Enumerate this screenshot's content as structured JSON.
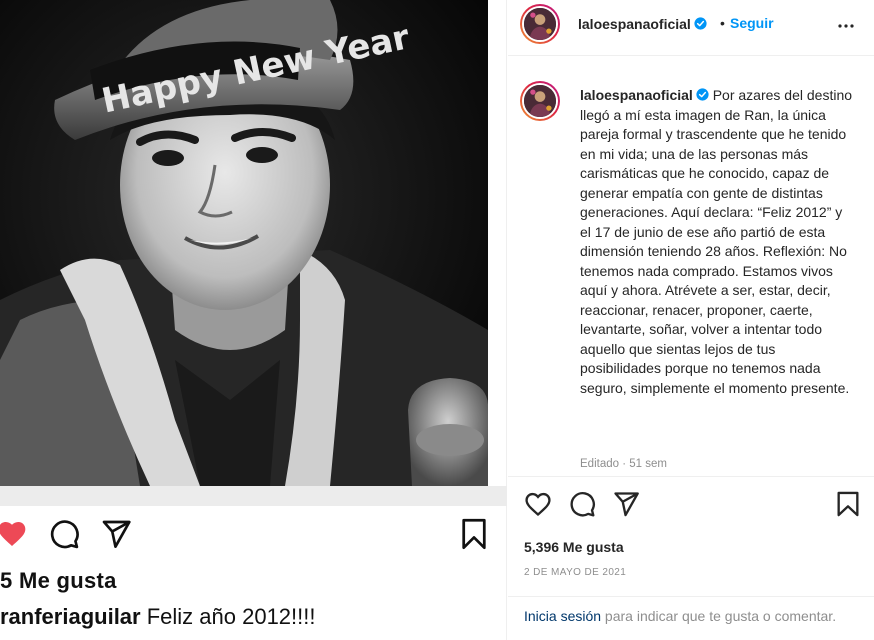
{
  "post": {
    "username": "laloespanaoficial",
    "follow_label": "Seguir",
    "dot": "•",
    "caption_text": "Por azares del destino llegó a mí esta imagen de Ran, la única pareja formal y trascendente que he tenido en mi vida; una de las personas más carismáticas que he conocido, capaz de generar empatía con gente de distintas generaciones. Aquí declara: “Feliz 2012” y el 17 de junio de ese año partió de esta dimensión teniendo 28 años. Reflexión: No tenemos nada comprado. Estamos vivos aquí y ahora. Atrévete a ser, estar, decir, reaccionar, renacer, proponer, caerte, levantarte, soñar, volver a intentar todo aquello que sientas lejos de tus posibilidades porque no tenemos nada seguro, simplemente el momento presente.",
    "edited": "Editado · 51 sem",
    "likes": "5,396 Me gusta",
    "date": "2 DE MAYO DE 2021",
    "login_link": "Inicia sesión",
    "login_rest": " para indicar que te gusta o comentar."
  },
  "embedded_post": {
    "hat_text": "Happy New Year",
    "likes": "5 Me gusta",
    "username": "ranferiaguilar",
    "caption": " Feliz año 2012!!!!"
  },
  "colors": {
    "link_blue": "#0095f6",
    "like_red": "#ed4956",
    "muted_gray": "#8e8e8e",
    "border": "#efefef"
  },
  "icons": {
    "verified": "verified-badge-icon",
    "more": "more-options-icon",
    "like": "heart-icon",
    "comment": "comment-icon",
    "share": "share-icon",
    "save": "bookmark-icon"
  }
}
